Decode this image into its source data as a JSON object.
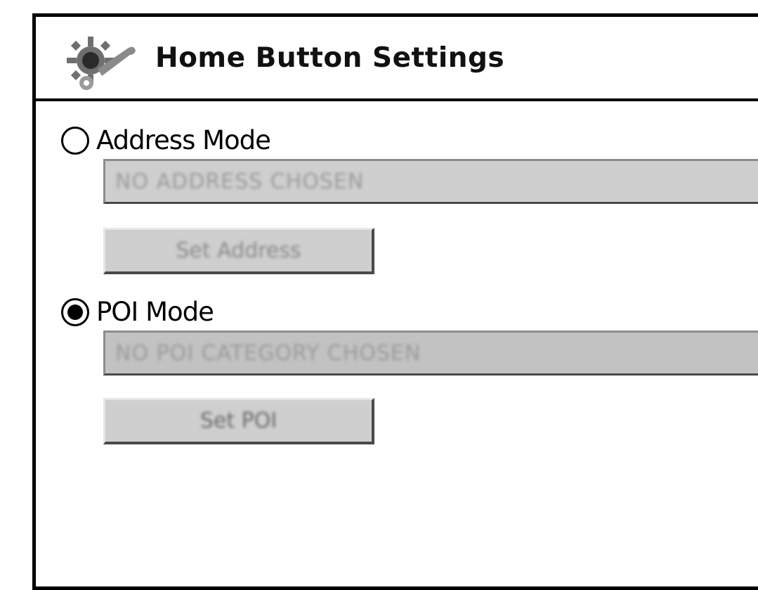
{
  "dialog": {
    "title": "Home Button Settings",
    "icon": "settings-wrench-gear-icon"
  },
  "address_mode": {
    "label": "Address Mode",
    "selected": false,
    "field_value": "NO ADDRESS CHOSEN",
    "button_label": "Set Address",
    "enabled": false
  },
  "poi_mode": {
    "label": "POI Mode",
    "selected": true,
    "field_value": "NO POI CATEGORY CHOSEN",
    "button_label": "Set POI",
    "enabled": true
  }
}
